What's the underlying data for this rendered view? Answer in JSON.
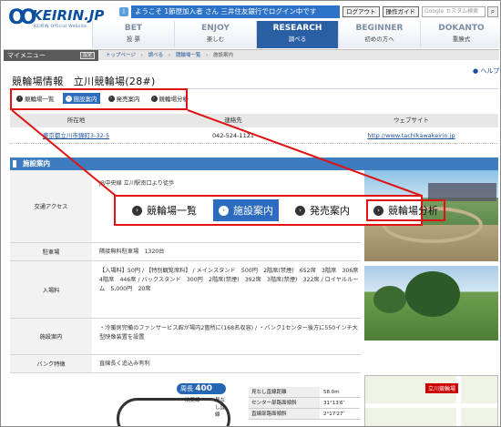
{
  "header": {
    "logo_text": "KEIRIN.JP",
    "logo_tag": "KEIRIN Official Website",
    "welcome": "ようこそ 1節歴加入者 さん 三井住友銀行でログイン中です",
    "logout_label": "ログアウト",
    "guide_label": "操作ガイド",
    "search_placeholder": "Google カスタム検索",
    "search_button": "検索"
  },
  "nav": [
    {
      "en": "BET",
      "jp": "投 票"
    },
    {
      "en": "ENJOY",
      "jp": "楽しむ"
    },
    {
      "en": "RESEARCH",
      "jp": "調べる"
    },
    {
      "en": "BEGINNER",
      "jp": "初めの方へ"
    },
    {
      "en": "DOKANTO",
      "jp": "重勝式"
    }
  ],
  "subbar": {
    "mymenu_label": "マイメニュー",
    "settings_label": "設定",
    "breadcrumb": [
      "トップページ",
      "調べる",
      "競輪場一覧",
      "施設案内"
    ]
  },
  "page": {
    "title": "競輪場情報　立川競輪場(28#)",
    "help_label": "ヘルプ",
    "subtabs": [
      "競輪場一覧",
      "施設案内",
      "発売案内",
      "競輪場分析"
    ],
    "table_headers": [
      "所在地",
      "連絡先",
      "ウェブサイト"
    ],
    "table_row": [
      "東京都立川市錦町3-32-5",
      "042-524-1121",
      "http://www.tachikawakeirin.jp"
    ],
    "section_title": "施設案内",
    "rows": [
      {
        "label": "交通アクセス",
        "value": "JR中央線 立川駅南口より徒歩"
      },
      {
        "label": "駐車場",
        "value": "隣接無料駐車場　1320台"
      },
      {
        "label": "入場料",
        "value": "【入場料】50円 / 【特別観覧席料】 / メインスタンド　500円　2階席(禁煙)　652席　3階席　306席　4階席　446席 / バックスタンド　300円　2階席(禁煙)　392席　3階席(禁煙)　322席 / ロイヤルルーム　5,000円　20席"
      },
      {
        "label": "施設案内",
        "value": "・冷暖房完備のファンサービス館が場内2箇所に(168名収容) / ・バンク1センター後方に550インチ大型映像装置を設置"
      },
      {
        "label": "バンク特徴",
        "value": "直線長く追込み有利"
      }
    ],
    "course": {
      "perimeter_label": "周長",
      "perimeter_value": "400 m",
      "goal_label": "決勝線",
      "mie_label": "見なし直線"
    },
    "stats": [
      {
        "k": "見なし直線距離",
        "v": "58.0m"
      },
      {
        "k": "センター部路面傾斜",
        "v": "31°13′6″"
      },
      {
        "k": "直線部路面傾斜",
        "v": "2°17′27″"
      }
    ],
    "map_label": "立川競輪場"
  },
  "colors": {
    "accent": "#2c6bbd",
    "highlight": "#e01313",
    "nav_active": "#2a5fa3"
  }
}
